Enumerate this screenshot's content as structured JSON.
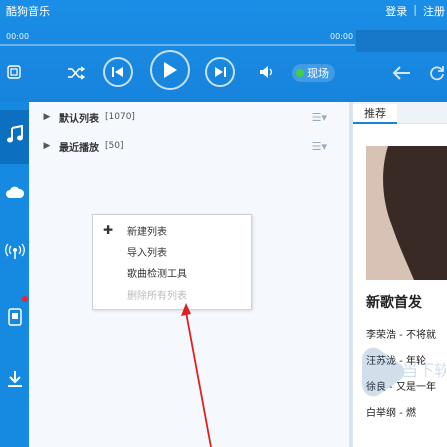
{
  "app": {
    "title": "酷狗音乐",
    "top_links": [
      "登录",
      "注册"
    ]
  },
  "player": {
    "time_elapsed": "00:00",
    "time_total": "00:00",
    "progress": 0,
    "live_label": "现场"
  },
  "icons": {
    "list": "list-icon",
    "shuffle": "shuffle-icon",
    "prev": "previous-icon",
    "play": "play-icon",
    "next": "next-icon",
    "volume": "volume-icon",
    "back": "back-arrow-icon",
    "refresh": "refresh-icon"
  },
  "sidebar": {
    "items": [
      {
        "icon": "music-note-icon",
        "active": true
      },
      {
        "icon": "cloud-icon",
        "active": false
      },
      {
        "icon": "radio-icon",
        "active": false
      },
      {
        "icon": "mobile-icon",
        "active": false
      },
      {
        "icon": "download-icon",
        "active": false
      }
    ]
  },
  "playlists": [
    {
      "name": "默认列表",
      "count": "[1070]"
    },
    {
      "name": "最近播放",
      "count": "[50]"
    }
  ],
  "context_menu": {
    "items": [
      {
        "label": "新建列表",
        "disabled": false
      },
      {
        "label": "导入列表",
        "disabled": false
      },
      {
        "label": "歌曲检测工具",
        "disabled": false
      },
      {
        "label": "删除所有列表",
        "disabled": true
      }
    ]
  },
  "right_panel": {
    "tabs": [
      "推荐"
    ],
    "section_title": "新歌首发",
    "recommendations": [
      "李荣浩 - 不将就",
      "汪苏泷 - 年轮",
      "徐良 - 又是一年",
      "白举纲 - 燃"
    ]
  },
  "watermark": "当下软件园",
  "colors": {
    "accent": "#1783dc",
    "header": "#1a8ee6",
    "annotation": "#e02020",
    "live_dot": "#3fd23f"
  }
}
